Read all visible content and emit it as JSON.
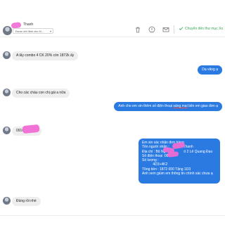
{
  "header": {
    "contact_name": "Thanh",
    "assign_dropdown": "Được chỉ định cho N...",
    "move_to_done": "Chuyển đến thư mục Xo"
  },
  "icons": {
    "delete": "trash-icon",
    "spam": "warning-icon",
    "mark_unread": "envelope-icon",
    "done": "check-icon"
  },
  "messages": [
    {
      "direction": "in",
      "text": "A lấy combo 4 CK 20% còn 1872k ấy"
    },
    {
      "direction": "out",
      "text": "Dạ vâng ạ"
    },
    {
      "direction": "in",
      "text": "Cho các cháu con chị gái a nữa"
    },
    {
      "direction": "out",
      "text_before": "Anh cho em xin thêm số điện thoại ",
      "text_underlined": "sáng mai",
      "text_after": " bên em giao đơn ạ"
    },
    {
      "direction": "in",
      "text": "0916"
    },
    {
      "direction": "in",
      "text": "Đúng rồi nhé"
    }
  ],
  "order_message": {
    "lines": [
      "Em xin xác nhận đơn hàng",
      "Tên người nhận :",
      "Địa chỉ : Bộ Ng",
      "Số điện thoại :081",
      "Số lượng :",
      "           4D3+4K2",
      "Tổng tiền : 1872 000 Tặng 1D3",
      "Anh xem giúm em thông tin chính xác chưa ạ"
    ],
    "name_suffix": "Thanh",
    "address_suffix": "ố 2 Lê Quang Đạo"
  },
  "colors": {
    "outgoing": "#2a7ae2",
    "incoming": "#eeeeee",
    "done": "#3aa757",
    "redaction": "#f06bd4"
  }
}
